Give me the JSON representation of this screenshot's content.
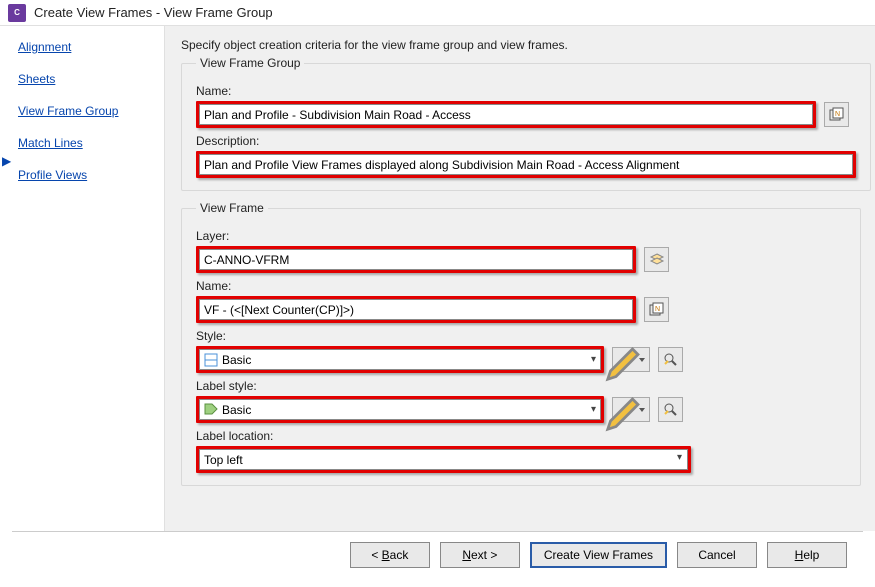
{
  "dialog": {
    "title": "Create View Frames - View Frame Group"
  },
  "nav": {
    "items": [
      "Alignment",
      "Sheets",
      "View Frame Group",
      "Match Lines",
      "Profile Views"
    ],
    "active_index": 2
  },
  "instruction": "Specify object creation criteria for the view frame group and view frames.",
  "group": {
    "legend": "View Frame Group",
    "name_label": "Name:",
    "name_value": "Plan and Profile - Subdivision Main Road - Access",
    "desc_label": "Description:",
    "desc_value": "Plan and Profile View Frames displayed along Subdivision Main Road - Access Alignment"
  },
  "frame": {
    "legend": "View Frame",
    "layer_label": "Layer:",
    "layer_value": "C-ANNO-VFRM",
    "name_label": "Name:",
    "name_value": "VF - (<[Next Counter(CP)]>)",
    "style_label": "Style:",
    "style_value": "Basic",
    "labelstyle_label": "Label style:",
    "labelstyle_value": "Basic",
    "labelloc_label": "Label location:",
    "labelloc_value": "Top left"
  },
  "buttons": {
    "back": "< Back",
    "next": "Next >",
    "create": "Create View Frames",
    "cancel": "Cancel",
    "help": "Help"
  },
  "icons": {
    "name_template": "name-template-icon",
    "layer_picker": "layer-picker-icon",
    "edit_style": "edit-style-icon",
    "style_search": "style-preview-icon"
  }
}
